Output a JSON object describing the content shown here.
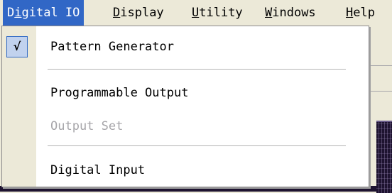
{
  "menubar": {
    "items": [
      {
        "pre": "D",
        "acc": "i",
        "post": "gital IO",
        "active": true
      },
      {
        "pre": "",
        "acc": "D",
        "post": "isplay",
        "active": false
      },
      {
        "pre": "",
        "acc": "U",
        "post": "tility",
        "active": false
      },
      {
        "pre": "",
        "acc": "W",
        "post": "indows",
        "active": false
      },
      {
        "pre": "",
        "acc": "H",
        "post": "elp",
        "active": false
      }
    ]
  },
  "dropdown": {
    "items": [
      {
        "label": "Pattern Generator",
        "checked": true,
        "check_glyph": "√",
        "enabled": true
      },
      {
        "label": "Programmable Output",
        "checked": false,
        "enabled": true
      },
      {
        "label": "Output Set",
        "checked": false,
        "enabled": false
      },
      {
        "label": "Digital Input",
        "checked": false,
        "enabled": true
      }
    ]
  },
  "colors": {
    "menu_highlight": "#3167c6",
    "check_background": "#c1d2ee",
    "disabled_text": "#a7a6aa"
  }
}
